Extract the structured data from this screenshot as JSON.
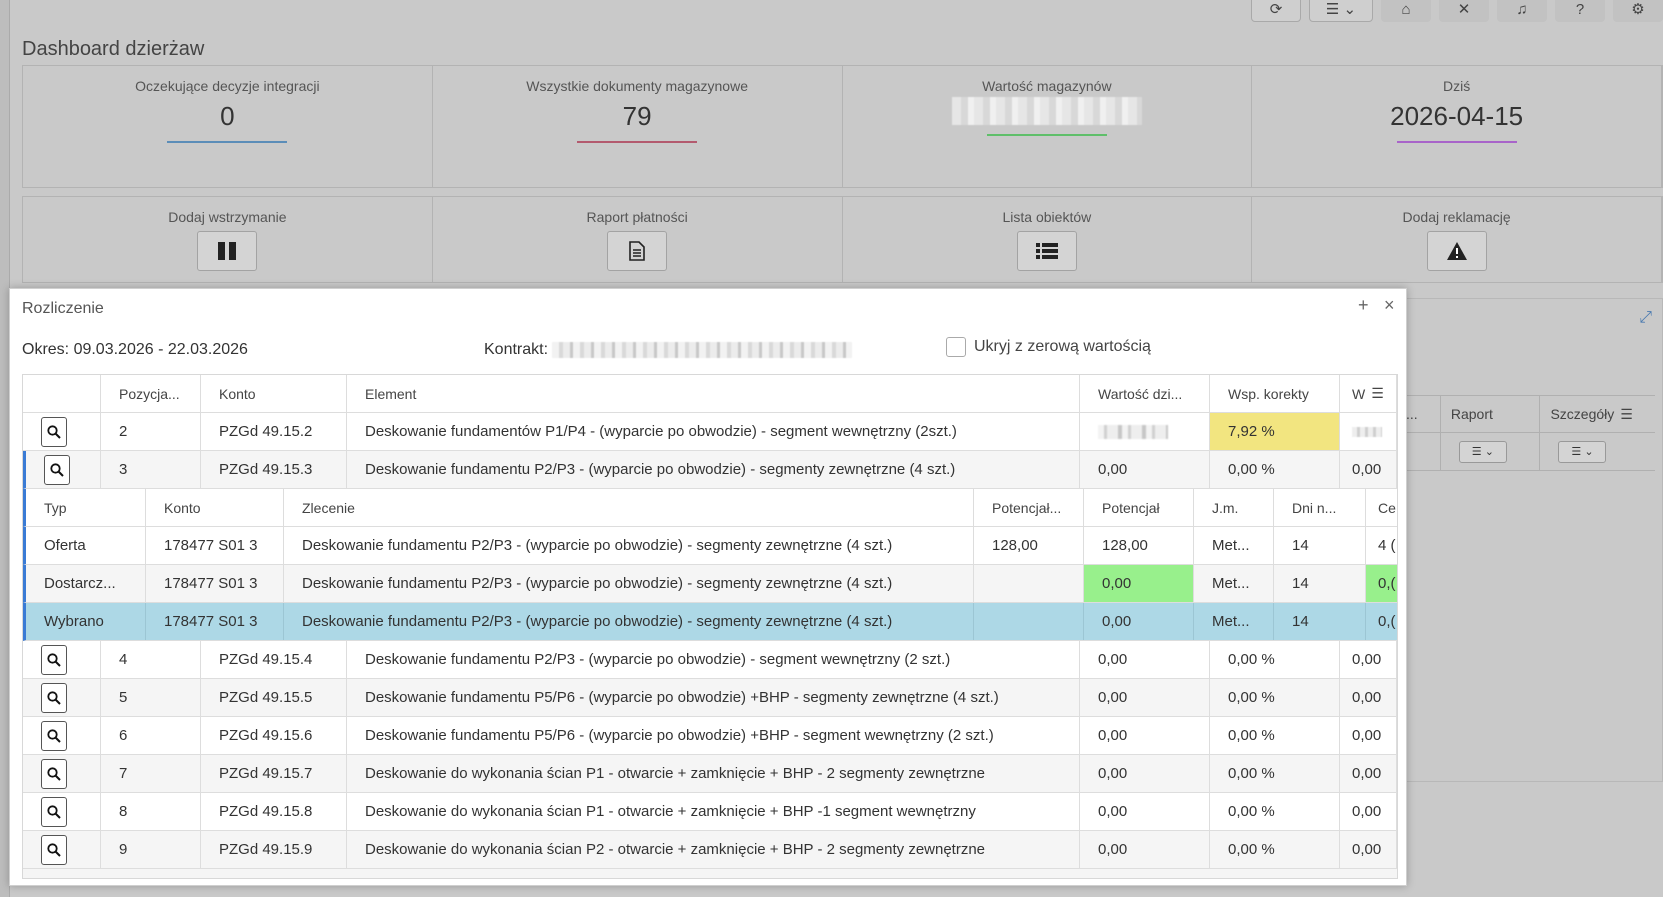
{
  "page": {
    "title": "Dashboard dzierżaw"
  },
  "tiles": [
    {
      "label": "Oczekujące decyzje integracji",
      "value": "0",
      "color": "#5b8db8"
    },
    {
      "label": "Wszystkie dokumenty magazynowe",
      "value": "79",
      "color": "#b35a6e"
    },
    {
      "label": "Wartość magazynów",
      "value": "",
      "color": "#5fbf6a"
    },
    {
      "label": "Dziś",
      "value": "2026-04-15",
      "color": "#a864c9"
    }
  ],
  "actions": [
    {
      "label": "Dodaj wstrzymanie",
      "icon": "pause-icon"
    },
    {
      "label": "Raport płatności",
      "icon": "document-icon"
    },
    {
      "label": "Lista obiektów",
      "icon": "list-icon"
    },
    {
      "label": "Dodaj reklamację",
      "icon": "warning-icon"
    }
  ],
  "background_table": {
    "headers": [
      "...",
      "Raport",
      "Szczegóły"
    ]
  },
  "modal": {
    "title": "Rozliczenie",
    "period": "Okres: 09.03.2026 - 22.03.2026",
    "contract_label": "Kontrakt:",
    "hide_zero_label": "Ukryj z zerową wartością",
    "columns": [
      "",
      "Pozycja...",
      "Konto",
      "Element",
      "Wartość dzi...",
      "Wsp. korekty",
      "W"
    ],
    "rows": [
      {
        "pos": "2",
        "konto": "PZGd 49.15.2",
        "element": "Deskowanie fundamentów P1/P4 - (wyparcie po obwodzie) - segment wewnętrzny (2szt.)",
        "wartosc": "",
        "wsp": "7,92 %",
        "w": ""
      },
      {
        "pos": "3",
        "konto": "PZGd 49.15.3",
        "element": "Deskowanie fundamentu P2/P3 - (wyparcie po obwodzie) - segmenty zewnętrzne (4 szt.)",
        "wartosc": "0,00",
        "wsp": "0,00 %",
        "w": "0,00"
      }
    ],
    "sub_columns": [
      "Typ",
      "Konto",
      "Zlecenie",
      "Potencjał...",
      "Potencjał",
      "J.m.",
      "Dni n...",
      "Ce"
    ],
    "sub_rows": [
      {
        "typ": "Oferta",
        "konto": "178477 S01 3",
        "zlecenie": "Deskowanie fundamentu P2/P3 - (wyparcie po obwodzie) - segmenty zewnętrzne (4 szt.)",
        "pot1": "128,00",
        "pot2": "128,00",
        "jm": "Met...",
        "dni": "14",
        "ce": "4 ("
      },
      {
        "typ": "Dostarcz...",
        "konto": "178477 S01 3",
        "zlecenie": "Deskowanie fundamentu P2/P3 - (wyparcie po obwodzie) - segmenty zewnętrzne (4 szt.)",
        "pot1": "",
        "pot2": "0,00",
        "jm": "Met...",
        "dni": "14",
        "ce": "0,("
      },
      {
        "typ": "Wybrano",
        "konto": "178477 S01 3",
        "zlecenie": "Deskowanie fundamentu P2/P3 - (wyparcie po obwodzie) - segmenty zewnętrzne (4 szt.)",
        "pot1": "",
        "pot2": "0,00",
        "jm": "Met...",
        "dni": "14",
        "ce": "0,("
      }
    ],
    "rows_after": [
      {
        "pos": "4",
        "konto": "PZGd 49.15.4",
        "element": "Deskowanie fundamentu P2/P3 - (wyparcie po obwodzie) - segment wewnętrzny (2 szt.)",
        "wartosc": "0,00",
        "wsp": "0,00 %",
        "w": "0,00"
      },
      {
        "pos": "5",
        "konto": "PZGd 49.15.5",
        "element": "Deskowanie fundamentu P5/P6 - (wyparcie po obwodzie) +BHP - segmenty zewnętrzne (4 szt.)",
        "wartosc": "0,00",
        "wsp": "0,00 %",
        "w": "0,00"
      },
      {
        "pos": "6",
        "konto": "PZGd 49.15.6",
        "element": "Deskowanie fundamentu P5/P6 - (wyparcie po obwodzie) +BHP - segment wewnętrzny (2 szt.)",
        "wartosc": "0,00",
        "wsp": "0,00 %",
        "w": "0,00"
      },
      {
        "pos": "7",
        "konto": "PZGd 49.15.7",
        "element": "Deskowanie do wykonania ścian P1 - otwarcie + zamknięcie + BHP - 2 segmenty zewnętrzne",
        "wartosc": "0,00",
        "wsp": "0,00 %",
        "w": "0,00"
      },
      {
        "pos": "8",
        "konto": "PZGd 49.15.8",
        "element": "Deskowanie do wykonania ścian P1 - otwarcie + zamknięcie + BHP -1 segment wewnętrzny",
        "wartosc": "0,00",
        "wsp": "0,00 %",
        "w": "0,00"
      },
      {
        "pos": "9",
        "konto": "PZGd 49.15.9",
        "element": "Deskowanie do wykonania ścian P2 - otwarcie + zamknięcie + BHP - 2 segmenty zewnętrzne",
        "wartosc": "0,00",
        "wsp": "0,00 %",
        "w": "0,00"
      }
    ]
  }
}
